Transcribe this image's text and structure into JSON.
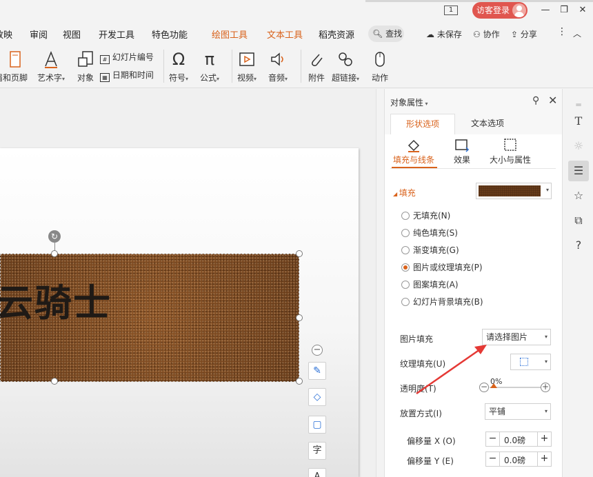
{
  "titlebar": {
    "slide_counter": "1",
    "login_label": "访客登录",
    "minimize": "—",
    "restore": "❐",
    "close": "✕"
  },
  "tabs": [
    {
      "label": "放映"
    },
    {
      "label": "审阅"
    },
    {
      "label": "视图"
    },
    {
      "label": "开发工具"
    },
    {
      "label": "特色功能"
    },
    {
      "label": "绘图工具"
    },
    {
      "label": "文本工具"
    },
    {
      "label": "稻壳资源"
    }
  ],
  "search_label": "查找",
  "right_tools": {
    "unsaved": "未保存",
    "collab": "协作",
    "share": "分享"
  },
  "ribbon": {
    "header_footer": "眉和页脚",
    "wordart": "艺术字",
    "object": "对象",
    "slide_number": "幻灯片编号",
    "date_time": "日期和时间",
    "symbol": "符号",
    "formula": "公式",
    "video": "视频",
    "audio": "音频",
    "attachment": "附件",
    "hyperlink": "超链接",
    "action": "动作"
  },
  "slide": {
    "text": "云骑士"
  },
  "panel": {
    "title": "对象属性",
    "tab_shape": "形状选项",
    "tab_text": "文本选项",
    "subtabs": {
      "fill_line": "填充与线条",
      "effect": "效果",
      "size_props": "大小与属性"
    },
    "fill_header": "填充",
    "fill_options": [
      {
        "label": "无填充(N)",
        "selected": false
      },
      {
        "label": "纯色填充(S)",
        "selected": false
      },
      {
        "label": "渐变填充(G)",
        "selected": false
      },
      {
        "label": "图片或纹理填充(P)",
        "selected": true
      },
      {
        "label": "图案填充(A)",
        "selected": false
      },
      {
        "label": "幻灯片背景填充(B)",
        "selected": false
      }
    ],
    "picture_fill_label": "图片填充",
    "picture_fill_value": "请选择图片",
    "texture_fill_label": "纹理填充(U)",
    "transparency_label": "透明度(T)",
    "transparency_value": "0%",
    "placement_label": "放置方式(I)",
    "placement_value": "平铺",
    "offset_x_label": "偏移量 X (O)",
    "offset_x_value": "0.0磅",
    "offset_y_label": "偏移量 Y (E)",
    "offset_y_value": "0.0磅"
  },
  "accent_color": "#d9621b",
  "arrow_color": "#e53935"
}
